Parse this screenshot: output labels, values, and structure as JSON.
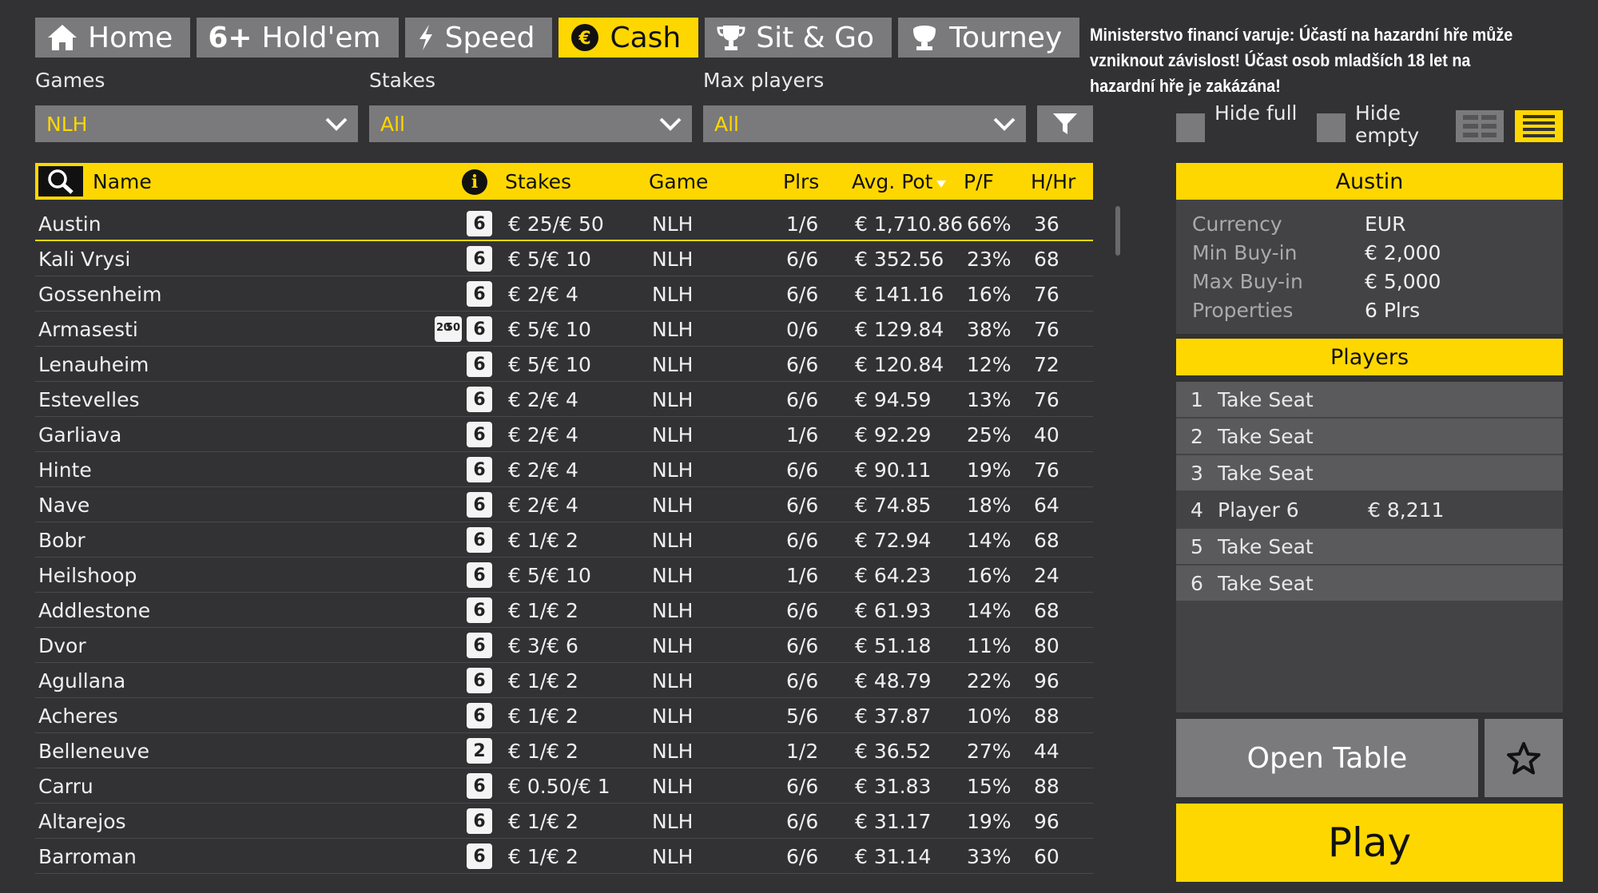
{
  "tabs": [
    {
      "label": "Home",
      "icon": "home-icon",
      "active": false
    },
    {
      "label": "Hold'em",
      "icon": "six-plus-icon",
      "icon_text": "6+",
      "active": false
    },
    {
      "label": "Speed",
      "icon": "lightning-icon",
      "active": false
    },
    {
      "label": "Cash",
      "icon": "euro-coin-icon",
      "active": true
    },
    {
      "label": "Sit & Go",
      "icon": "trophy-icon",
      "active": false
    },
    {
      "label": "Tourney",
      "icon": "cup-icon",
      "active": false
    }
  ],
  "warning": "Ministerstvo financí varuje: Účastí na hazardní hře může vzniknout závislost! Účast osob mladších 18 let na hazardní hře je zakázána!",
  "filters": {
    "games": {
      "label": "Games",
      "value": "NLH"
    },
    "stakes": {
      "label": "Stakes",
      "value": "All"
    },
    "max_players": {
      "label": "Max players",
      "value": "All"
    }
  },
  "table": {
    "columns": {
      "name": "Name",
      "stakes": "Stakes",
      "game": "Game",
      "plrs": "Plrs",
      "avg_pot": "Avg. Pot",
      "pf": "P/F",
      "hhr": "H/Hr"
    },
    "rows": [
      {
        "name": "Austin",
        "badge": "6",
        "stakes": "€ 25/€ 50",
        "game": "NLH",
        "plrs": "1/6",
        "avg_pot": "€ 1,710.86",
        "pf": "66%",
        "hhr": "36"
      },
      {
        "name": "Kali Vrysi",
        "badge": "6",
        "stakes": "€ 5/€ 10",
        "game": "NLH",
        "plrs": "6/6",
        "avg_pot": "€ 352.56",
        "pf": "23%",
        "hhr": "68"
      },
      {
        "name": "Gossenheim",
        "badge": "6",
        "stakes": "€ 2/€ 4",
        "game": "NLH",
        "plrs": "6/6",
        "avg_pot": "€ 141.16",
        "pf": "16%",
        "hhr": "76"
      },
      {
        "name": "Armasesti",
        "badge": "6",
        "badge2_top": "20",
        "badge2_bottom": "50",
        "stakes": "€ 5/€ 10",
        "game": "NLH",
        "plrs": "0/6",
        "avg_pot": "€ 129.84",
        "pf": "38%",
        "hhr": "76"
      },
      {
        "name": "Lenauheim",
        "badge": "6",
        "stakes": "€ 5/€ 10",
        "game": "NLH",
        "plrs": "6/6",
        "avg_pot": "€ 120.84",
        "pf": "12%",
        "hhr": "72"
      },
      {
        "name": "Estevelles",
        "badge": "6",
        "stakes": "€ 2/€ 4",
        "game": "NLH",
        "plrs": "6/6",
        "avg_pot": "€ 94.59",
        "pf": "13%",
        "hhr": "76"
      },
      {
        "name": "Garliava",
        "badge": "6",
        "stakes": "€ 2/€ 4",
        "game": "NLH",
        "plrs": "1/6",
        "avg_pot": "€ 92.29",
        "pf": "25%",
        "hhr": "40"
      },
      {
        "name": "Hinte",
        "badge": "6",
        "stakes": "€ 2/€ 4",
        "game": "NLH",
        "plrs": "6/6",
        "avg_pot": "€ 90.11",
        "pf": "19%",
        "hhr": "76"
      },
      {
        "name": "Nave",
        "badge": "6",
        "stakes": "€ 2/€ 4",
        "game": "NLH",
        "plrs": "6/6",
        "avg_pot": "€ 74.85",
        "pf": "18%",
        "hhr": "64"
      },
      {
        "name": "Bobr",
        "badge": "6",
        "stakes": "€ 1/€ 2",
        "game": "NLH",
        "plrs": "6/6",
        "avg_pot": "€ 72.94",
        "pf": "14%",
        "hhr": "68"
      },
      {
        "name": "Heilshoop",
        "badge": "6",
        "stakes": "€ 5/€ 10",
        "game": "NLH",
        "plrs": "1/6",
        "avg_pot": "€ 64.23",
        "pf": "16%",
        "hhr": "24"
      },
      {
        "name": "Addlestone",
        "badge": "6",
        "stakes": "€ 1/€ 2",
        "game": "NLH",
        "plrs": "6/6",
        "avg_pot": "€ 61.93",
        "pf": "14%",
        "hhr": "68"
      },
      {
        "name": "Dvor",
        "badge": "6",
        "stakes": "€ 3/€ 6",
        "game": "NLH",
        "plrs": "6/6",
        "avg_pot": "€ 51.18",
        "pf": "11%",
        "hhr": "80"
      },
      {
        "name": "Agullana",
        "badge": "6",
        "stakes": "€ 1/€ 2",
        "game": "NLH",
        "plrs": "6/6",
        "avg_pot": "€ 48.79",
        "pf": "22%",
        "hhr": "96"
      },
      {
        "name": "Acheres",
        "badge": "6",
        "stakes": "€ 1/€ 2",
        "game": "NLH",
        "plrs": "5/6",
        "avg_pot": "€ 37.87",
        "pf": "10%",
        "hhr": "88"
      },
      {
        "name": "Belleneuve",
        "badge": "2",
        "stakes": "€ 1/€ 2",
        "game": "NLH",
        "plrs": "1/2",
        "avg_pot": "€ 36.52",
        "pf": "27%",
        "hhr": "44"
      },
      {
        "name": "Carru",
        "badge": "6",
        "stakes": "€ 0.50/€ 1",
        "game": "NLH",
        "plrs": "6/6",
        "avg_pot": "€ 31.83",
        "pf": "15%",
        "hhr": "88"
      },
      {
        "name": "Altarejos",
        "badge": "6",
        "stakes": "€ 1/€ 2",
        "game": "NLH",
        "plrs": "6/6",
        "avg_pot": "€ 31.17",
        "pf": "19%",
        "hhr": "96"
      },
      {
        "name": "Barroman",
        "badge": "6",
        "stakes": "€ 1/€ 2",
        "game": "NLH",
        "plrs": "6/6",
        "avg_pot": "€ 31.14",
        "pf": "33%",
        "hhr": "60"
      }
    ]
  },
  "options": {
    "hide_full": "Hide full",
    "hide_empty": "Hide empty"
  },
  "details": {
    "title": "Austin",
    "rows": [
      {
        "key": "Currency",
        "value": "EUR"
      },
      {
        "key": "Min Buy-in",
        "value": "€ 2,000"
      },
      {
        "key": "Max Buy-in",
        "value": "€ 5,000"
      },
      {
        "key": "Properties",
        "value": "6 Plrs"
      }
    ]
  },
  "players": {
    "title": "Players",
    "seats": [
      {
        "num": "1",
        "label": "Take Seat",
        "amount": ""
      },
      {
        "num": "2",
        "label": "Take Seat",
        "amount": ""
      },
      {
        "num": "3",
        "label": "Take Seat",
        "amount": ""
      },
      {
        "num": "4",
        "label": "Player 6",
        "amount": "€ 8,211"
      },
      {
        "num": "5",
        "label": "Take Seat",
        "amount": ""
      },
      {
        "num": "6",
        "label": "Take Seat",
        "amount": ""
      }
    ]
  },
  "buttons": {
    "open_table": "Open Table",
    "play": "Play"
  },
  "colors": {
    "accent": "#ffd700",
    "background": "#323234",
    "button": "#7a7a7c",
    "panel": "#434345"
  }
}
